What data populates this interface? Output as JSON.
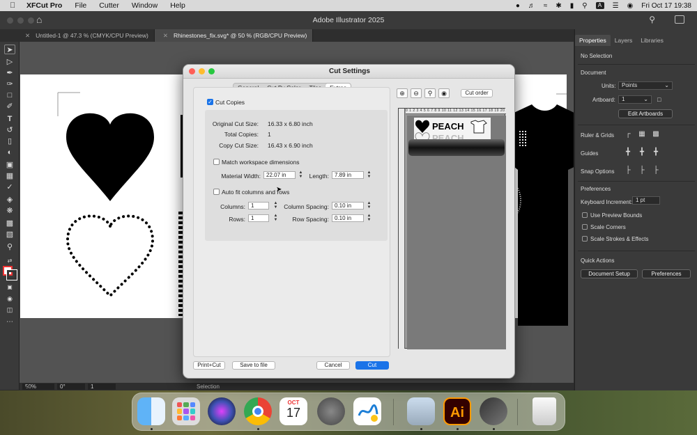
{
  "menubar": {
    "app_name": "XFCut Pro",
    "items": [
      "File",
      "Cutter",
      "Window",
      "Help"
    ],
    "input_badge": "A",
    "clock": "Fri Oct 17  19:38"
  },
  "window": {
    "title": "Adobe Illustrator 2025"
  },
  "doc_tabs": [
    {
      "label": "Untitled-1 @ 47.3 % (CMYK/CPU Preview)"
    },
    {
      "label": "Rhinestones_fix.svg* @ 50 % (RGB/CPU Preview)"
    }
  ],
  "status": {
    "zoom": "50%",
    "angle": "0°",
    "artboard": "1",
    "mode": "Selection"
  },
  "panel": {
    "tabs": [
      "Properties",
      "Layers",
      "Libraries"
    ],
    "no_selection": "No Selection",
    "document_heading": "Document",
    "units_label": "Units:",
    "units_value": "Points",
    "artboard_label": "Artboard:",
    "artboard_value": "1",
    "edit_artboards": "Edit Artboards",
    "ruler_grids": "Ruler & Grids",
    "guides": "Guides",
    "snap_options": "Snap Options",
    "preferences_heading": "Preferences",
    "keyboard_increment_label": "Keyboard Increment:",
    "keyboard_increment_value": "1 pt",
    "use_preview_bounds": "Use Preview Bounds",
    "scale_corners": "Scale Corners",
    "scale_strokes": "Scale Strokes & Effects",
    "quick_actions": "Quick Actions",
    "document_setup": "Document Setup",
    "preferences_button": "Preferences"
  },
  "dialog": {
    "title": "Cut Settings",
    "tabs": [
      "General",
      "Cut By Color",
      "Tiles",
      "Extras"
    ],
    "active_tab": "Extras",
    "cut_copies_label": "Cut Copies",
    "cut_copies_checked": true,
    "original_cut_size_label": "Original Cut Size:",
    "original_cut_size": "16.33 x 6.80 inch",
    "total_copies_label": "Total Copies:",
    "total_copies": "1",
    "copy_cut_size_label": "Copy Cut Size:",
    "copy_cut_size": "16.43 x 6.90 inch",
    "match_workspace_label": "Match workspace dimensions",
    "material_width_label": "Material Width:",
    "material_width": "22.07 in",
    "length_label": "Length:",
    "length": "7.89 in",
    "auto_fit_label": "Auto fit columns and rows",
    "columns_label": "Columns:",
    "columns": "1",
    "column_spacing_label": "Column Spacing:",
    "column_spacing": "0.10 in",
    "rows_label": "Rows:",
    "rows": "1",
    "row_spacing_label": "Row Spacing:",
    "row_spacing": "0.10 in",
    "cut_order": "Cut order",
    "ruler_ticks": "0 1 2 3 4 5 6 7 8 9 10 11 12 13 14 15 16 17 18 19 20 21 22",
    "preview_text_top": "PEACH",
    "preview_text_bottom": "PEACH",
    "print_cut": "Print+Cut",
    "save_to_file": "Save to file",
    "cancel": "Cancel",
    "cut": "Cut"
  },
  "colors": {
    "accent": "#1a73e8",
    "ai_orange": "#ff9a00",
    "ai_bg": "#330000"
  },
  "dock": {
    "icons": [
      "finder-icon",
      "launchpad-icon",
      "siri-icon",
      "chrome-icon",
      "calendar-icon",
      "system-settings-icon",
      "freeform-icon",
      "xfcut-icon",
      "illustrator-icon",
      "xfcut-pro-icon",
      "trash-icon"
    ],
    "calendar_month": "OCT",
    "calendar_day": "17",
    "illustrator_label": "Ai"
  }
}
